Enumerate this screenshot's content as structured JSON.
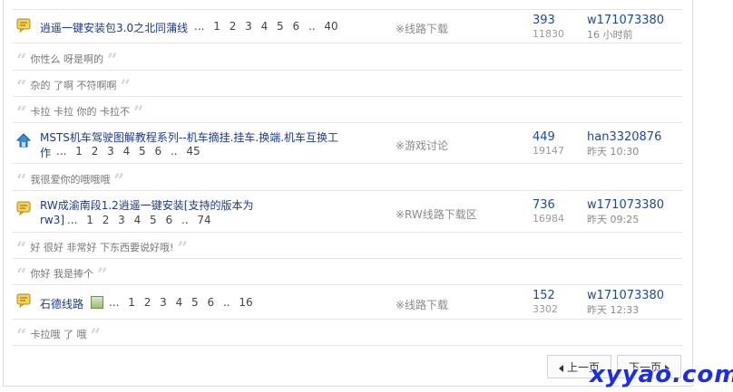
{
  "topics": [
    {
      "title": "逍遥一键安装包3.0之北同蒲线",
      "pages": "... 1 2 3 4 5 6 .. 40",
      "forum": "※线路下载",
      "replies": "393",
      "views": "11830",
      "author": "w171073380",
      "time": "16 小时前",
      "icon": "speech-bubble-icon",
      "comments": [
        "你性么 呀是啊的",
        "杂的 了啊 不符啊啊",
        "卡拉 卡拉 你的 卡拉不"
      ]
    },
    {
      "title_line1": "MSTS机车驾驶图解教程系列--机车摘挂.挂车.换端.机车互换工",
      "title_line2": "作",
      "pages": "... 1 2 3 4 5 6 .. 45",
      "forum": "※游戏讨论",
      "replies": "449",
      "views": "19147",
      "author": "han3320876",
      "time": "昨天 10:30",
      "icon": "up-arrow-house-icon",
      "comments": [
        "我很爱你的哦哦哦"
      ]
    },
    {
      "title_line1": "RW成渝南段1.2逍遥一键安装[支持的版本为",
      "title_line2": "rw3]",
      "pages": "... 1 2 3 4 5 6 .. 74",
      "forum": "※RW线路下载区",
      "replies": "736",
      "views": "16984",
      "author": "w171073380",
      "time": "昨天 09:25",
      "icon": "speech-bubble-icon",
      "comments": [
        "好 很好 非常好 下东西要说好哦!",
        "你好 我是捧个"
      ]
    },
    {
      "title": "石德线路",
      "pages": "... 1 2 3 4 5 6 .. 16",
      "forum": "※线路下载",
      "replies": "152",
      "views": "3302",
      "author": "w171073380",
      "time": "昨天 12:33",
      "icon": "speech-bubble-icon",
      "comments": [
        "卡拉哦 了 哦"
      ]
    }
  ],
  "pager": {
    "prev": "上一页",
    "next": "下一页"
  },
  "watermark": "xyyao.com"
}
